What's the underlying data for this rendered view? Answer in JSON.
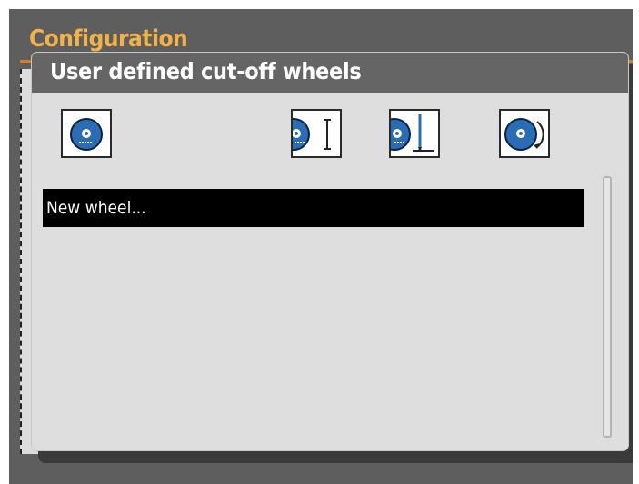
{
  "background": {
    "title": "Configuration",
    "accent_color": "#e07a1e",
    "title_color": "#f2b24a"
  },
  "dialog": {
    "title": "User defined cut-off wheels",
    "toolbar": [
      {
        "name": "wheel-icon"
      },
      {
        "name": "wheel-thickness-icon"
      },
      {
        "name": "wheel-depth-icon"
      },
      {
        "name": "wheel-rotation-icon"
      }
    ],
    "list": {
      "items": [
        "New wheel..."
      ],
      "selected_index": 0
    }
  },
  "colors": {
    "wheel_blue": "#2a6db5",
    "header_gray": "#656565",
    "selection_bg": "#000000"
  }
}
